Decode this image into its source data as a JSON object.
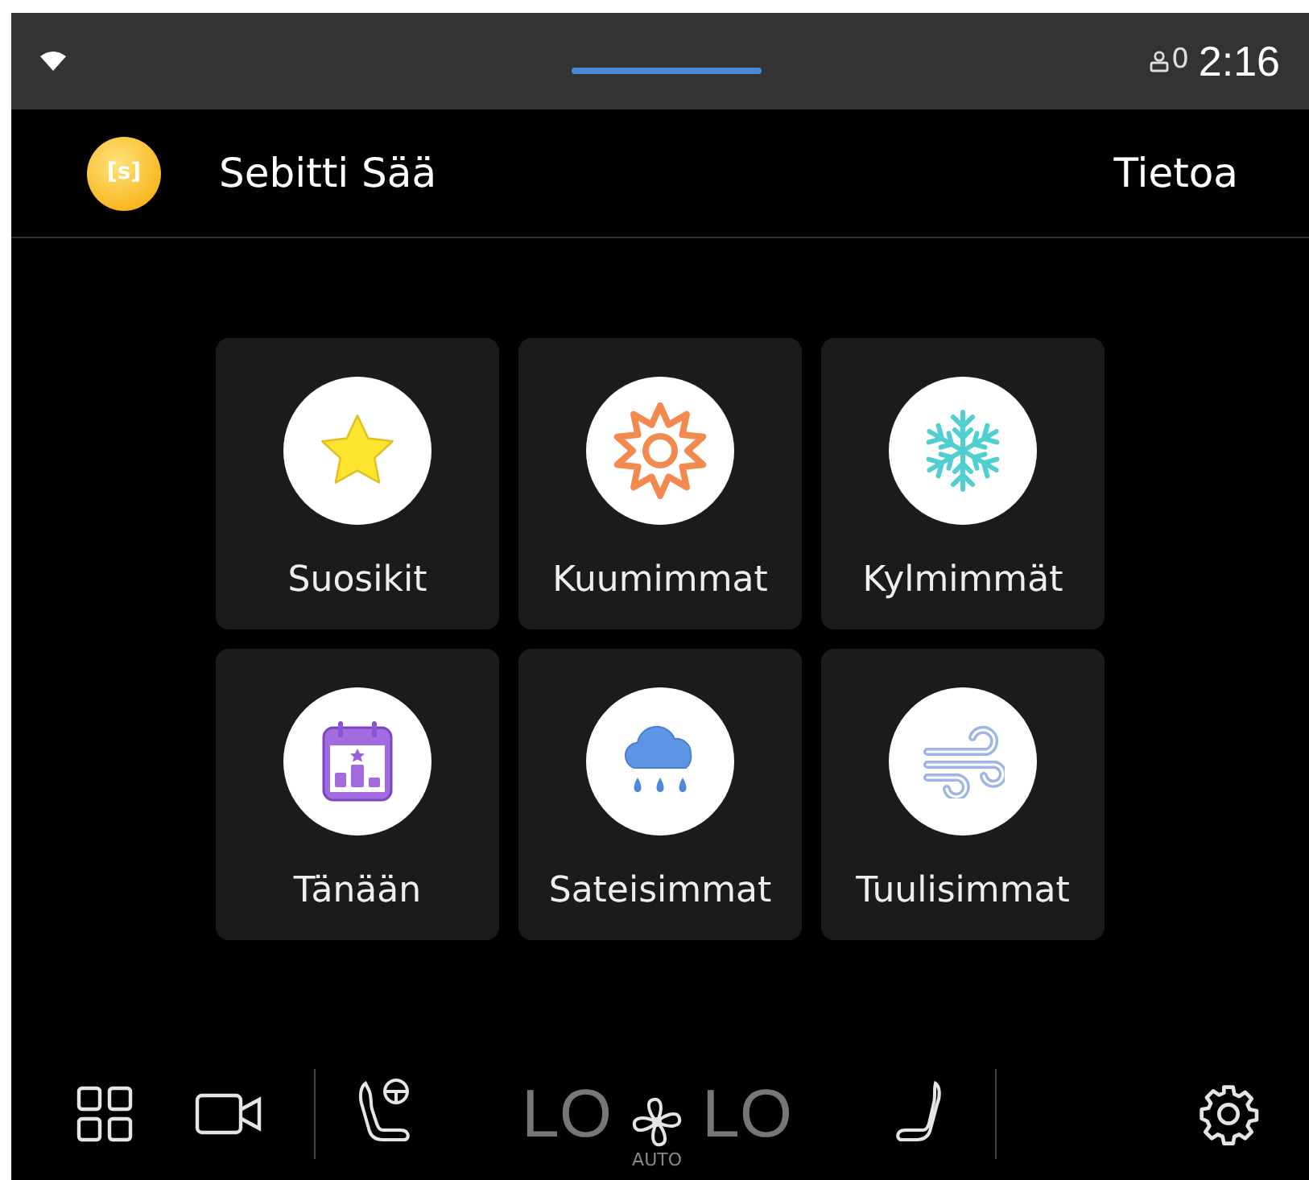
{
  "status_bar": {
    "user_count": "0",
    "time": "2:16"
  },
  "header": {
    "logo_text": "[s]",
    "app_name": "Sebitti Sää",
    "about": "Tietoa"
  },
  "tiles": [
    {
      "label": "Suosikit",
      "kind": "star"
    },
    {
      "label": "Kuumimmat",
      "kind": "sun"
    },
    {
      "label": "Kylmimmät",
      "kind": "snow"
    },
    {
      "label": "Tänään",
      "kind": "calendar"
    },
    {
      "label": "Sateisimmat",
      "kind": "rain"
    },
    {
      "label": "Tuulisimmat",
      "kind": "wind"
    }
  ],
  "climate_bar": {
    "left_temp": "LO",
    "fan_label": "AUTO",
    "right_temp": "LO"
  }
}
